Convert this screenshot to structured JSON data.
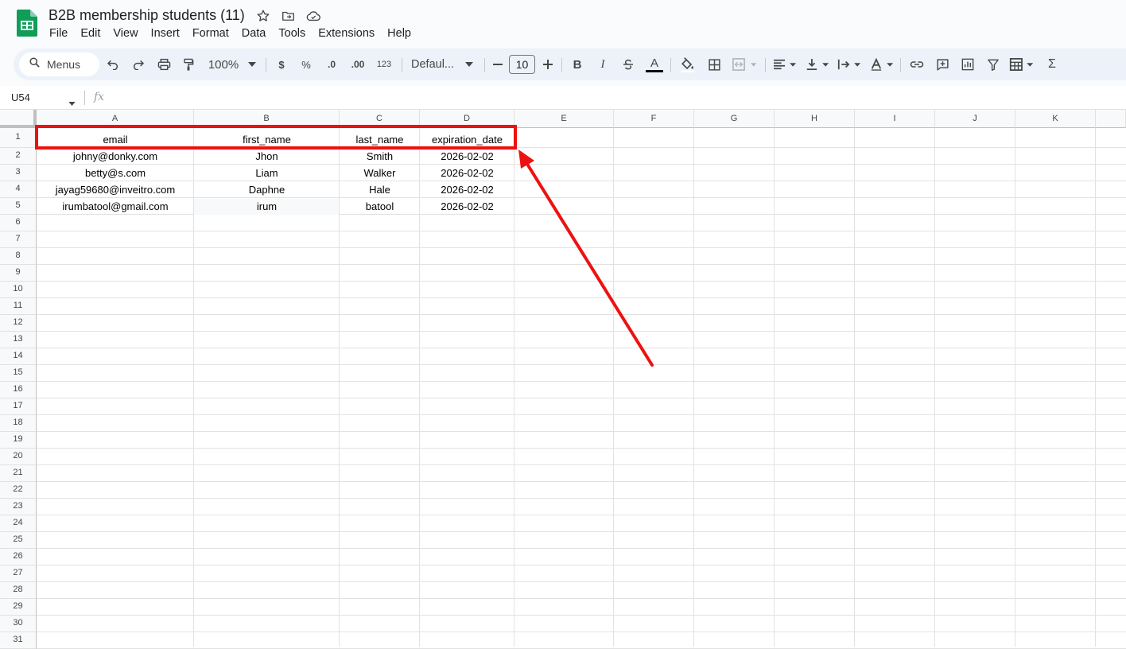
{
  "titlebar": {
    "doc_title": "B2B membership students (11)",
    "icons": [
      "star-icon",
      "move-to-folder-icon",
      "cloud-saved-icon"
    ]
  },
  "menu": [
    "File",
    "Edit",
    "View",
    "Insert",
    "Format",
    "Data",
    "Tools",
    "Extensions",
    "Help"
  ],
  "toolbar": {
    "search_label": "Menus",
    "zoom": "100%",
    "currency": "$",
    "percent": "%",
    "decrease_decimal": ".0",
    "increase_decimal": ".00",
    "number_format": "123",
    "font_family": "Defaul...",
    "font_size": "10",
    "bold": "B",
    "italic": "I",
    "strikethrough": "S",
    "text_color": "A",
    "function_symbol": "Σ"
  },
  "formula_bar": {
    "cell_ref": "U54",
    "fx": "fx",
    "content": ""
  },
  "columns": [
    "A",
    "B",
    "C",
    "D",
    "E",
    "F",
    "G",
    "H",
    "I",
    "J",
    "K"
  ],
  "rows": [
    "1",
    "2",
    "3",
    "4",
    "5",
    "6",
    "7",
    "8",
    "9",
    "10",
    "11",
    "12",
    "13",
    "14",
    "15",
    "16",
    "17",
    "18",
    "19",
    "20",
    "21",
    "22",
    "23",
    "24",
    "25",
    "26",
    "27",
    "28",
    "29",
    "30",
    "31"
  ],
  "table": {
    "headers": [
      "email",
      "first_name",
      "last_name",
      "expiration_date"
    ],
    "data": [
      [
        "johny@donky.com",
        "Jhon",
        "Smith",
        "2026-02-02"
      ],
      [
        "betty@s.com",
        "Liam",
        "Walker",
        "2026-02-02"
      ],
      [
        "jayag59680@inveitro.com",
        "Daphne",
        "Hale",
        "2026-02-02"
      ],
      [
        "irumbatool@gmail.com",
        "irum",
        "batool",
        "2026-02-02"
      ]
    ]
  },
  "annotation": {
    "color": "#ee1111",
    "highlighted": "header-row"
  },
  "colors": {
    "sheets_green": "#0f9d58",
    "toolbar_bg": "#edf2fa",
    "chrome_bg": "#f9fbfd"
  }
}
